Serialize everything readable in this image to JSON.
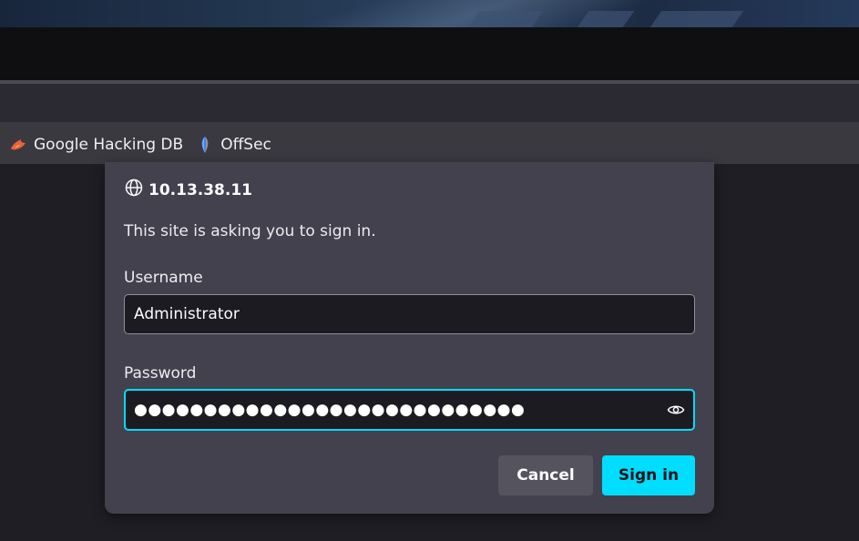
{
  "bookmarks": [
    {
      "label": "Google Hacking DB",
      "icon": "exploit-db-flame-icon",
      "color": "#e8623a"
    },
    {
      "label": "OffSec",
      "icon": "offsec-logo-icon",
      "color": "#3b82f6"
    }
  ],
  "dialog": {
    "host": "10.13.38.11",
    "message": "This site is asking you to sign in.",
    "username_label": "Username",
    "username_value": "Administrator",
    "password_label": "Password",
    "password_mask": "●●●●●●●●●●●●●●●●●●●●●●●●●●●●",
    "cancel_label": "Cancel",
    "signin_label": "Sign in"
  },
  "colors": {
    "accent": "#00ddff",
    "dialog_bg": "#42414d",
    "input_bg": "#1c1b22"
  }
}
